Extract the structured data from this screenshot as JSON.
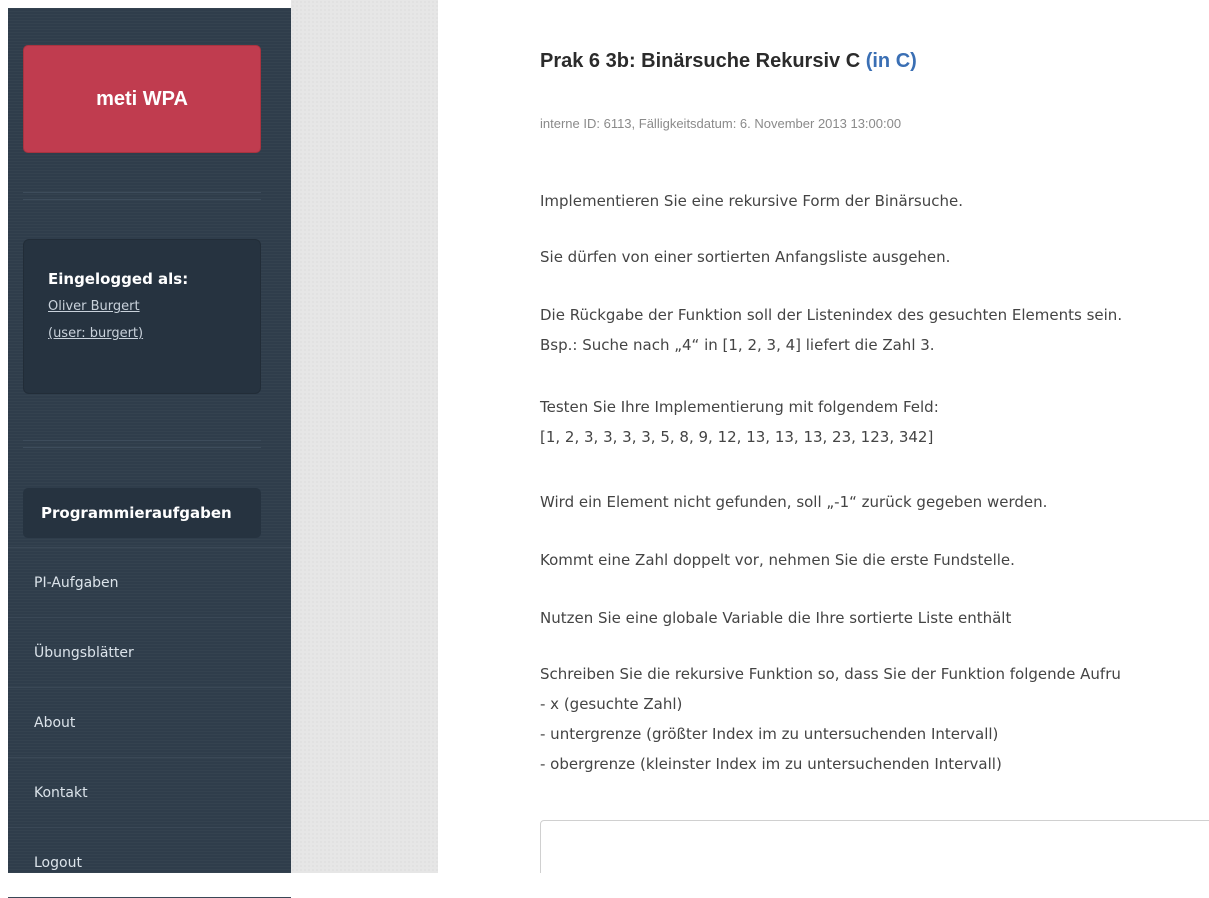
{
  "brand": {
    "name": "meti WPA"
  },
  "login": {
    "heading": "Eingelogged als:",
    "name": "Oliver Burgert",
    "user": "(user: burgert)"
  },
  "nav": [
    {
      "label": "Programmieraufgaben",
      "active": true
    },
    {
      "label": "PI-Aufgaben"
    },
    {
      "label": "Übungsblätter"
    },
    {
      "label": "About"
    },
    {
      "label": "Kontakt"
    },
    {
      "label": "Logout"
    }
  ],
  "task": {
    "title": "Prak 6 3b: Binärsuche Rekursiv C",
    "language": "(in C)",
    "meta": "interne ID: 6113, Fälligkeitsdatum: 6. November 2013 13:00:00",
    "paragraphs": [
      [
        "Implementieren Sie eine rekursive Form der Binärsuche."
      ],
      [
        "Sie dürfen von einer sortierten Anfangsliste ausgehen."
      ],
      [
        "Die Rückgabe der Funktion soll der Listenindex des gesuchten Elements sein.",
        "Bsp.: Suche nach „4“ in [1, 2, 3, 4] liefert die Zahl 3."
      ],
      [
        "Testen Sie Ihre Implementierung mit folgendem Feld:",
        "[1, 2, 3, 3, 3, 3, 5, 8, 9, 12, 13, 13, 13, 23, 123, 342]"
      ],
      [
        "Wird ein Element nicht gefunden, soll „-1“ zurück gegeben werden."
      ],
      [
        "Kommt eine Zahl doppelt vor, nehmen Sie die erste Fundstelle."
      ],
      [
        "Nutzen Sie eine globale Variable die Ihre sortierte Liste enthält"
      ],
      [
        "Schreiben Sie die rekursive Funktion so, dass Sie der Funktion folgende Aufru",
        "- x (gesuchte Zahl)",
        "- untergrenze (größter Index im zu untersuchenden Intervall)",
        "- obergrenze (kleinster Index im zu untersuchenden Intervall)"
      ]
    ]
  },
  "colors": {
    "sidebar": "#2f3d4b",
    "brand": "#c03c4f",
    "link_blue": "#3a6fb4",
    "gutter": "#e6e6e6"
  }
}
